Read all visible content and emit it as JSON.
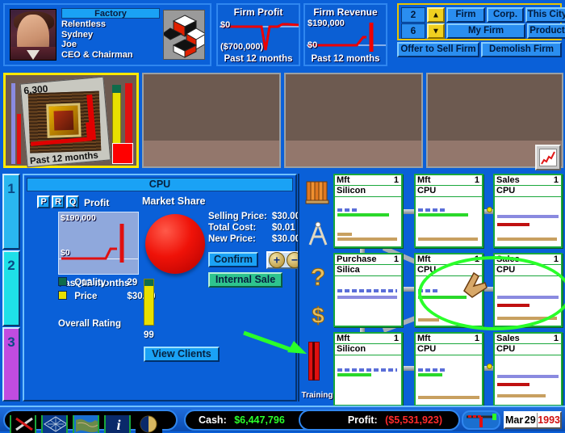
{
  "firm": {
    "title": "Factory",
    "name": "Relentless",
    "city": "Sydney",
    "owner": "Joe",
    "role": "CEO & Chairman",
    "portrait_alt": "ceo-portrait",
    "logo_alt": "cube-logo"
  },
  "charts": {
    "profit": {
      "title": "Firm Profit",
      "top_label": "$0",
      "bottom_label": "($700,000)",
      "footer": "Past 12 months"
    },
    "revenue": {
      "title": "Firm Revenue",
      "top_label": "$190,000",
      "bottom_label": "$0",
      "footer": "Past 12 months"
    }
  },
  "controls": {
    "count_top": "2",
    "count_bottom": "6",
    "up_arrow": "▲",
    "down_arrow": "▼",
    "firm": "Firm",
    "corp": "Corp.",
    "this_city": "This City",
    "my_firm": "My Firm",
    "product": "Product",
    "offer_to_sell": "Offer to Sell Firm",
    "demolish": "Demolish Firm"
  },
  "city": {
    "thumb_value": "6,300",
    "thumb_footer": "Past 12 months",
    "graph_icon": "line-chart-icon"
  },
  "tabs": [
    {
      "label": "1",
      "color": "#2ab7f0",
      "selected": true
    },
    {
      "label": "2",
      "color": "#1fe0e8",
      "selected": false
    },
    {
      "label": "3",
      "color": "#c04ce0",
      "selected": false
    }
  ],
  "cpu_panel": {
    "title": "CPU",
    "prq": [
      "P",
      "R",
      "Q"
    ],
    "profit_label": "Profit",
    "market_share_label": "Market Share",
    "chart": {
      "top_label": "$190,000",
      "zero_label": "$0",
      "footer": "Past 12 months"
    },
    "prices": [
      {
        "key": "Selling Price:",
        "value": "$30.00"
      },
      {
        "key": "Total Cost:",
        "value": "$0.01"
      },
      {
        "key": "New Price:",
        "value": "$30.00"
      }
    ],
    "confirm_label": "Confirm",
    "plus_label": "+",
    "minus_label": "−",
    "internal_sale_label": "Internal Sale",
    "ratings": [
      {
        "label": "Quality",
        "value": "29",
        "color": "#0f6b4a"
      },
      {
        "label": "Price",
        "value": "$30.00",
        "color": "#e8e000"
      }
    ],
    "overall_rating_label": "Overall Rating",
    "overall_rating_value": "99",
    "view_clients_label": "View Clients"
  },
  "toolbar": {
    "items": [
      {
        "name": "books-icon",
        "label": ""
      },
      {
        "name": "compass-icon",
        "label": ""
      },
      {
        "name": "question-icon",
        "label": ""
      },
      {
        "name": "dollar-icon",
        "label": ""
      },
      {
        "name": "training-bar-icon",
        "label": "Training"
      }
    ],
    "training_caption": "Training"
  },
  "units": [
    {
      "type": "Mft",
      "product": "Silicon",
      "count": "1",
      "row": 0,
      "col": 0
    },
    {
      "type": "Mft",
      "product": "CPU",
      "count": "1",
      "row": 0,
      "col": 1
    },
    {
      "type": "Sales",
      "product": "CPU",
      "count": "1",
      "row": 0,
      "col": 2
    },
    {
      "type": "Purchase",
      "product": "Silica",
      "count": "1",
      "row": 1,
      "col": 0
    },
    {
      "type": "Mft",
      "product": "CPU",
      "count": "1",
      "row": 1,
      "col": 1
    },
    {
      "type": "Sales",
      "product": "CPU",
      "count": "1",
      "row": 1,
      "col": 2
    },
    {
      "type": "Mft",
      "product": "Silicon",
      "count": "1",
      "row": 2,
      "col": 0
    },
    {
      "type": "Mft",
      "product": "CPU",
      "count": "1",
      "row": 2,
      "col": 1
    },
    {
      "type": "Sales",
      "product": "CPU",
      "count": "1",
      "row": 2,
      "col": 2
    }
  ],
  "annotations": {
    "highlight_color": "#2aff2a",
    "arrow_color": "#2aff2a",
    "cursor": "pointing-hand-cursor"
  },
  "status": {
    "cash_label": "Cash:",
    "cash_value": "$6,447,796",
    "profit_label": "Profit:",
    "profit_value": "($5,531,923)",
    "month": "Mar",
    "day": "29",
    "year": "1993",
    "cash_color": "#2aff2a",
    "profit_color": "#ff2a2a",
    "icons": [
      {
        "name": "tools-icon"
      },
      {
        "name": "grid-map-icon"
      },
      {
        "name": "world-map-icon"
      },
      {
        "name": "info-icon"
      },
      {
        "name": "clock-icon"
      }
    ],
    "speed_icon": "speed-control-icon"
  }
}
